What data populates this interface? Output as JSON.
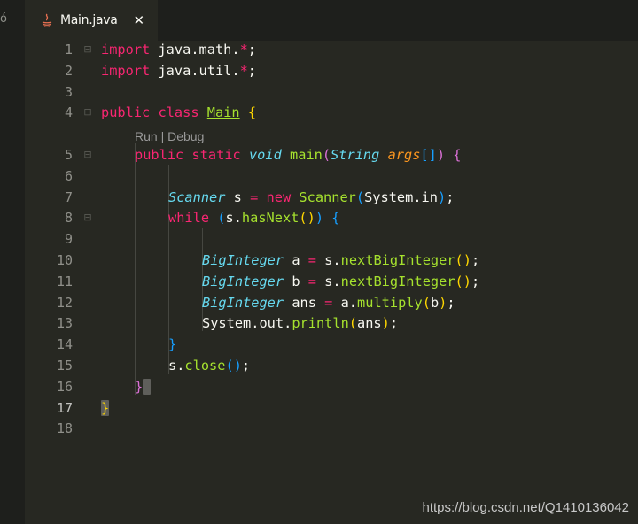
{
  "tab": {
    "label": "Main.java",
    "close": "✕"
  },
  "codelens": {
    "run": "Run",
    "separator": "|",
    "debug": "Debug"
  },
  "line_numbers": [
    "1",
    "2",
    "3",
    "4",
    "5",
    "6",
    "7",
    "8",
    "9",
    "10",
    "11",
    "12",
    "13",
    "14",
    "15",
    "16",
    "17",
    "18"
  ],
  "active_line": "17",
  "code": {
    "l1": [
      "import",
      " java.math.",
      "*",
      ";"
    ],
    "l2": [
      "import",
      " java.util.",
      "*",
      ";"
    ],
    "l4": [
      "public",
      " ",
      "class",
      " ",
      "Main",
      " ",
      "{"
    ],
    "l5": [
      "public",
      " ",
      "static",
      " ",
      "void",
      " ",
      "main",
      "(",
      "String",
      " ",
      "args",
      "[]",
      ")",
      " ",
      "{"
    ],
    "l7": [
      "Scanner",
      " s ",
      "=",
      " ",
      "new",
      " ",
      "Scanner",
      "(",
      "System.in",
      ")",
      ";"
    ],
    "l8": [
      "while",
      " ",
      "(",
      "s.",
      "hasNext",
      "()",
      ")",
      " ",
      "{"
    ],
    "l10": [
      "BigInteger",
      " a ",
      "=",
      " s.",
      "nextBigInteger",
      "()",
      ";"
    ],
    "l11": [
      "BigInteger",
      " b ",
      "=",
      " s.",
      "nextBigInteger",
      "()",
      ";"
    ],
    "l12": [
      "BigInteger",
      " ans ",
      "=",
      " a.",
      "multiply",
      "(",
      "b",
      ")",
      ";"
    ],
    "l13": [
      "System.out.",
      "println",
      "(",
      "ans",
      ")",
      ";"
    ],
    "l14": [
      "}"
    ],
    "l15": [
      "s.",
      "close",
      "()",
      ";"
    ],
    "l16": [
      "}"
    ],
    "l17": [
      "}"
    ]
  },
  "watermark": "https://blog.csdn.net/Q1410136042",
  "icons": {
    "java": "java-file-icon",
    "close": "close-icon",
    "fold": "fold-marker-icon"
  },
  "colors": {
    "background": "#272822",
    "keyword": "#f92672",
    "function": "#a6e22e",
    "type": "#66d9ef",
    "parameter": "#fd971f",
    "bracket_level1": "#ffd700",
    "bracket_level2": "#da70d6",
    "bracket_level3": "#179fff"
  }
}
